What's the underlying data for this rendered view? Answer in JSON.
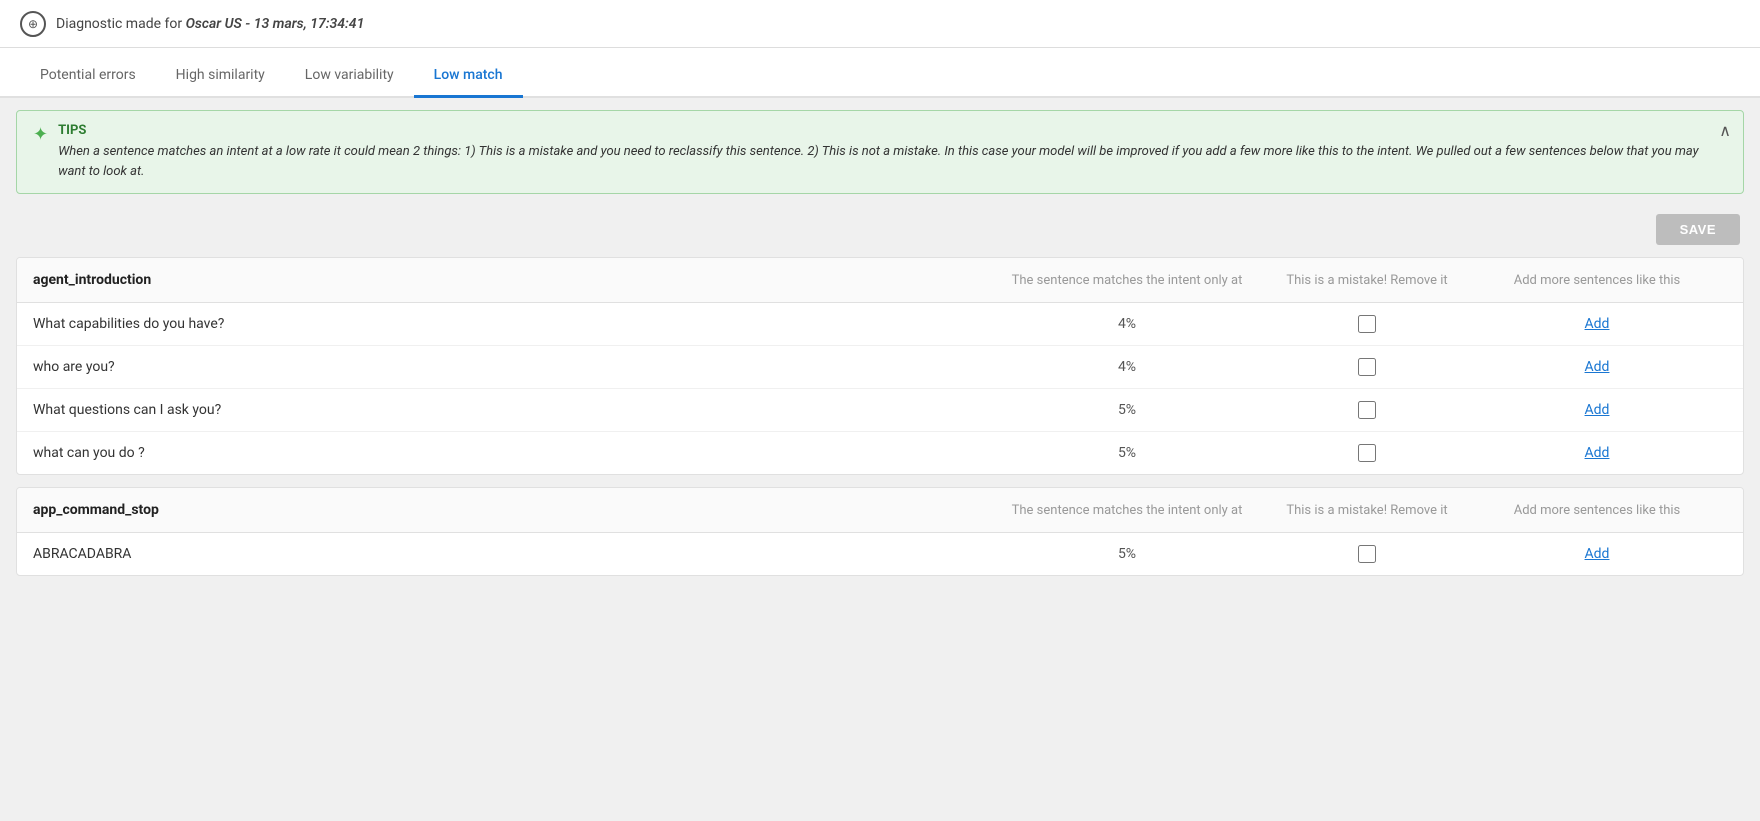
{
  "header": {
    "icon": "⊕",
    "title_static": "Diagnostic made for ",
    "title_dynamic": "Oscar US - 13 mars, 17:34:41"
  },
  "tabs": [
    {
      "id": "potential-errors",
      "label": "Potential errors",
      "active": false
    },
    {
      "id": "high-similarity",
      "label": "High similarity",
      "active": false
    },
    {
      "id": "low-variability",
      "label": "Low variability",
      "active": false
    },
    {
      "id": "low-match",
      "label": "Low match",
      "active": true
    }
  ],
  "tips": {
    "title": "TIPS",
    "text": "When a sentence matches an intent at a low rate it could mean 2 things: 1) This is a mistake and you need to reclassify this sentence. 2) This is not a mistake. In this case your model will be improved if you add a few more like this to the intent. We pulled out a few sentences below that you may want to look at."
  },
  "save_button": "SAVE",
  "intents": [
    {
      "name": "agent_introduction",
      "col1": "The sentence matches the intent only at",
      "col2": "This is a mistake! Remove it",
      "col3": "Add more sentences like this",
      "rows": [
        {
          "sentence": "What capabilities do you have?",
          "percent": "4%",
          "add_label": "Add"
        },
        {
          "sentence": "who are you?",
          "percent": "4%",
          "add_label": "Add"
        },
        {
          "sentence": "What questions can I ask you?",
          "percent": "5%",
          "add_label": "Add"
        },
        {
          "sentence": "what can you do ?",
          "percent": "5%",
          "add_label": "Add"
        }
      ]
    },
    {
      "name": "app_command_stop",
      "col1": "The sentence matches the intent only at",
      "col2": "This is a mistake! Remove it",
      "col3": "Add more sentences like this",
      "rows": [
        {
          "sentence": "ABRACADABRA",
          "percent": "5%",
          "add_label": "Add"
        }
      ]
    }
  ]
}
